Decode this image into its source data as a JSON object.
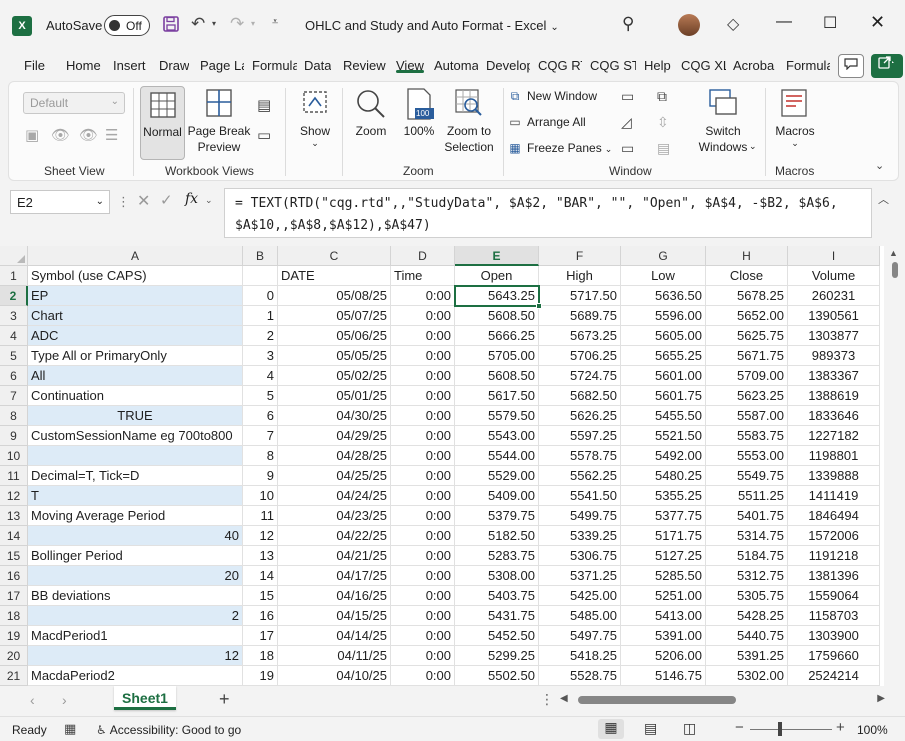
{
  "title_bar": {
    "app_icon": "X",
    "autosave_label": "AutoSave",
    "autosave_state": "Off",
    "document_title": "OHLC and Study and Auto Format  -  Excel",
    "icons": [
      "save-icon",
      "undo-icon",
      "redo-icon",
      "customize-qat-icon",
      "search-icon",
      "diamond-icon",
      "minimize-icon",
      "maximize-icon",
      "close-icon"
    ]
  },
  "menu_tabs": [
    "File",
    "Home",
    "Insert",
    "Draw",
    "Page La",
    "Formula",
    "Data",
    "Review",
    "View",
    "Automa",
    "Develop",
    "CQG RT",
    "CQG ST",
    "Help",
    "CQG XL",
    "Acroba",
    "Formula"
  ],
  "active_tab": "View",
  "ribbon": {
    "sheet_view": {
      "select_value": "Default",
      "label": "Sheet View"
    },
    "workbook_views": {
      "normal": "Normal",
      "page_break_preview_l1": "Page Break",
      "page_break_preview_l2": "Preview",
      "label": "Workbook Views"
    },
    "show": {
      "label": "Show"
    },
    "zoom": {
      "zoom": "Zoom",
      "hundred": "100%",
      "hundred_badge": "100",
      "zoom_to_selection_l1": "Zoom to",
      "zoom_to_selection_l2": "Selection",
      "label": "Zoom"
    },
    "window": {
      "new_window": "New Window",
      "arrange_all": "Arrange All",
      "freeze_panes": "Freeze Panes",
      "switch_windows_l1": "Switch",
      "switch_windows_l2": "Windows",
      "label": "Window"
    },
    "macros": {
      "macros": "Macros",
      "label": "Macros"
    }
  },
  "formula_bar": {
    "name_box": "E2",
    "fx": "fx",
    "formula": "= TEXT(RTD(\"cqg.rtd\",,\"StudyData\", $A$2, \"BAR\", \"\", \"Open\", $A$4, -$B2, $A$6, $A$10,,$A$8,$A$12),$A$47)"
  },
  "grid": {
    "columns": [
      "A",
      "B",
      "C",
      "D",
      "E",
      "F",
      "G",
      "H",
      "I"
    ],
    "selected_column": "E",
    "selected_row": 2,
    "rows": [
      {
        "n": "1",
        "cells": [
          "Symbol (use CAPS)",
          "",
          "DATE",
          "Time",
          "Open",
          "High",
          "Low",
          "Close",
          "Volume"
        ]
      },
      {
        "n": "2",
        "cells": [
          "EP",
          "0",
          "05/08/25",
          "0:00",
          "5643.25",
          "5717.50",
          "5636.50",
          "5678.25",
          "260231"
        ]
      },
      {
        "n": "3",
        "cells": [
          "Chart",
          "1",
          "05/07/25",
          "0:00",
          "5608.50",
          "5689.75",
          "5596.00",
          "5652.00",
          "1390561"
        ]
      },
      {
        "n": "4",
        "cells": [
          "ADC",
          "2",
          "05/06/25",
          "0:00",
          "5666.25",
          "5673.25",
          "5605.00",
          "5625.75",
          "1303877"
        ]
      },
      {
        "n": "5",
        "cells": [
          "Type All or PrimaryOnly",
          "3",
          "05/05/25",
          "0:00",
          "5705.00",
          "5706.25",
          "5655.25",
          "5671.75",
          "989373"
        ]
      },
      {
        "n": "6",
        "cells": [
          "All",
          "4",
          "05/02/25",
          "0:00",
          "5608.50",
          "5724.75",
          "5601.00",
          "5709.00",
          "1383367"
        ]
      },
      {
        "n": "7",
        "cells": [
          "Continuation",
          "5",
          "05/01/25",
          "0:00",
          "5617.50",
          "5682.50",
          "5601.75",
          "5623.25",
          "1388619"
        ]
      },
      {
        "n": "8",
        "cells": [
          "TRUE",
          "6",
          "04/30/25",
          "0:00",
          "5579.50",
          "5626.25",
          "5455.50",
          "5587.00",
          "1833646"
        ]
      },
      {
        "n": "9",
        "cells": [
          "CustomSessionName eg 700to800",
          "7",
          "04/29/25",
          "0:00",
          "5543.00",
          "5597.25",
          "5521.50",
          "5583.75",
          "1227182"
        ]
      },
      {
        "n": "10",
        "cells": [
          "",
          "8",
          "04/28/25",
          "0:00",
          "5544.00",
          "5578.75",
          "5492.00",
          "5553.00",
          "1198801"
        ]
      },
      {
        "n": "11",
        "cells": [
          "Decimal=T, Tick=D",
          "9",
          "04/25/25",
          "0:00",
          "5529.00",
          "5562.25",
          "5480.25",
          "5549.75",
          "1339888"
        ]
      },
      {
        "n": "12",
        "cells": [
          "T",
          "10",
          "04/24/25",
          "0:00",
          "5409.00",
          "5541.50",
          "5355.25",
          "5511.25",
          "1411419"
        ]
      },
      {
        "n": "13",
        "cells": [
          "Moving Average Period",
          "11",
          "04/23/25",
          "0:00",
          "5379.75",
          "5499.75",
          "5377.75",
          "5401.75",
          "1846494"
        ]
      },
      {
        "n": "14",
        "cells": [
          "40",
          "12",
          "04/22/25",
          "0:00",
          "5182.50",
          "5339.25",
          "5171.75",
          "5314.75",
          "1572006"
        ]
      },
      {
        "n": "15",
        "cells": [
          "Bollinger Period",
          "13",
          "04/21/25",
          "0:00",
          "5283.75",
          "5306.75",
          "5127.25",
          "5184.75",
          "1191218"
        ]
      },
      {
        "n": "16",
        "cells": [
          "20",
          "14",
          "04/17/25",
          "0:00",
          "5308.00",
          "5371.25",
          "5285.50",
          "5312.75",
          "1381396"
        ]
      },
      {
        "n": "17",
        "cells": [
          "BB deviations",
          "15",
          "04/16/25",
          "0:00",
          "5403.75",
          "5425.00",
          "5251.00",
          "5305.75",
          "1559064"
        ]
      },
      {
        "n": "18",
        "cells": [
          "2",
          "16",
          "04/15/25",
          "0:00",
          "5431.75",
          "5485.00",
          "5413.00",
          "5428.25",
          "1158703"
        ]
      },
      {
        "n": "19",
        "cells": [
          "MacdPeriod1",
          "17",
          "04/14/25",
          "0:00",
          "5452.50",
          "5497.75",
          "5391.00",
          "5440.75",
          "1303900"
        ]
      },
      {
        "n": "20",
        "cells": [
          "12",
          "18",
          "04/11/25",
          "0:00",
          "5299.25",
          "5418.25",
          "5206.00",
          "5391.25",
          "1759660"
        ]
      },
      {
        "n": "21",
        "cells": [
          "MacdaPeriod2",
          "19",
          "04/10/25",
          "0:00",
          "5502.50",
          "5528.75",
          "5146.75",
          "5302.00",
          "2524214"
        ]
      }
    ]
  },
  "sheet_tabs": {
    "active": "Sheet1"
  },
  "status_bar": {
    "ready": "Ready",
    "accessibility": "Accessibility: Good to go",
    "zoom": "100%"
  },
  "colors": {
    "excel_green": "#1d6f42",
    "input_highlight": "#ddebf7"
  }
}
